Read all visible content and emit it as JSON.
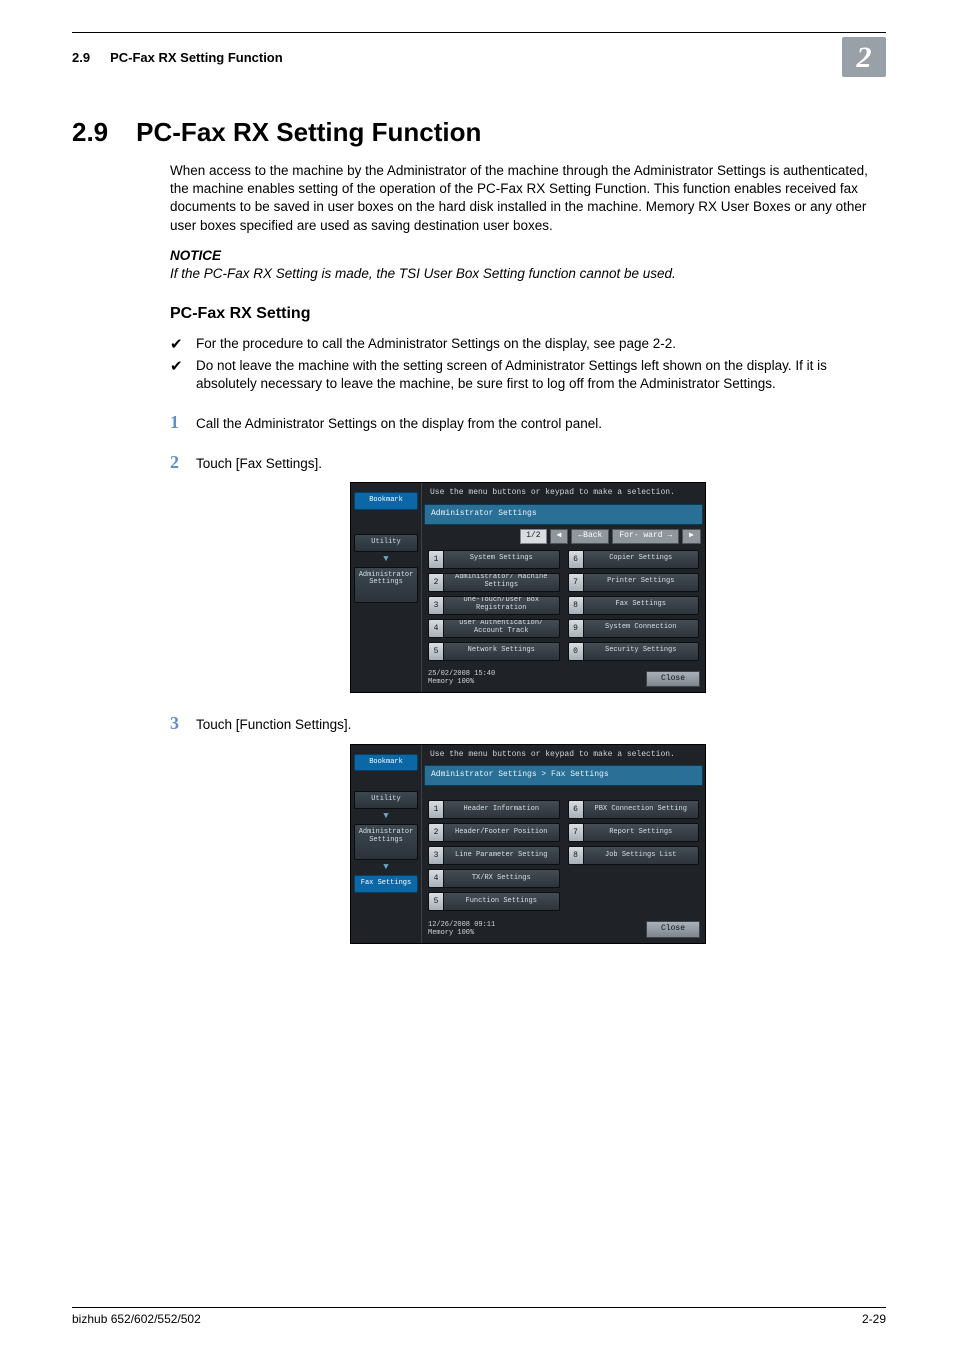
{
  "header": {
    "section_no": "2.9",
    "section_title": "PC-Fax RX Setting Function",
    "chapter_no": "2"
  },
  "h1": {
    "no": "2.9",
    "title": "PC-Fax RX Setting Function"
  },
  "intro": "When access to the machine by the Administrator of the machine through the Administrator Settings is authenticated, the machine enables setting of the operation of the PC-Fax RX Setting Function. This function enables received fax documents to be saved in user boxes on the hard disk installed in the machine. Memory RX User Boxes or any other user boxes specified are used as saving destination user boxes.",
  "notice_label": "NOTICE",
  "notice_text": "If the PC-Fax RX Setting is made, the TSI User Box Setting function cannot be used.",
  "h2": "PC-Fax RX Setting",
  "checks": [
    "For the procedure to call the Administrator Settings on the display, see page 2-2.",
    "Do not leave the machine with the setting screen of Administrator Settings left shown on the display. If it is absolutely necessary to leave the machine, be sure first to log off from the Administrator Settings."
  ],
  "steps": [
    {
      "n": "1",
      "text": "Call the Administrator Settings on the display from the control panel."
    },
    {
      "n": "2",
      "text": "Touch [Fax Settings]."
    },
    {
      "n": "3",
      "text": "Touch [Function Settings]."
    }
  ],
  "screen1": {
    "hint": "Use the menu buttons or keypad to make a selection.",
    "sidebar": {
      "bookmark": "Bookmark",
      "utility": "Utility",
      "admin": "Administrator Settings"
    },
    "crumb": "Administrator Settings",
    "page_indicator": "1/2",
    "back": "←Back",
    "forward": "For-\nward →",
    "left_items": [
      {
        "n": "1",
        "l": "System Settings"
      },
      {
        "n": "2",
        "l": "Administrator/\nMachine Settings"
      },
      {
        "n": "3",
        "l": "One-Touch/User Box\nRegistration"
      },
      {
        "n": "4",
        "l": "User Authentication/\nAccount Track"
      },
      {
        "n": "5",
        "l": "Network Settings"
      }
    ],
    "right_items": [
      {
        "n": "6",
        "l": "Copier Settings"
      },
      {
        "n": "7",
        "l": "Printer Settings"
      },
      {
        "n": "8",
        "l": "Fax Settings"
      },
      {
        "n": "9",
        "l": "System Connection"
      },
      {
        "n": "0",
        "l": "Security Settings"
      }
    ],
    "datetime": "25/02/2008   15:40",
    "memory": "Memory        100%",
    "close": "Close"
  },
  "screen2": {
    "hint": "Use the menu buttons or keypad to make a selection.",
    "sidebar": {
      "bookmark": "Bookmark",
      "utility": "Utility",
      "admin": "Administrator Settings",
      "fax": "Fax Settings"
    },
    "crumb": "Administrator Settings  >  Fax Settings",
    "left_items": [
      {
        "n": "1",
        "l": "Header\nInformation"
      },
      {
        "n": "2",
        "l": "Header/Footer\nPosition"
      },
      {
        "n": "3",
        "l": "Line Parameter Setting"
      },
      {
        "n": "4",
        "l": "TX/RX Settings"
      },
      {
        "n": "5",
        "l": "Function Settings"
      }
    ],
    "right_items": [
      {
        "n": "6",
        "l": "PBX Connection\nSetting"
      },
      {
        "n": "7",
        "l": "Report Settings"
      },
      {
        "n": "8",
        "l": "Job Settings\nList"
      }
    ],
    "datetime": "12/26/2008   09:11",
    "memory": "Memory        100%",
    "close": "Close"
  },
  "footer": {
    "left": "bizhub 652/602/552/502",
    "right": "2-29"
  }
}
